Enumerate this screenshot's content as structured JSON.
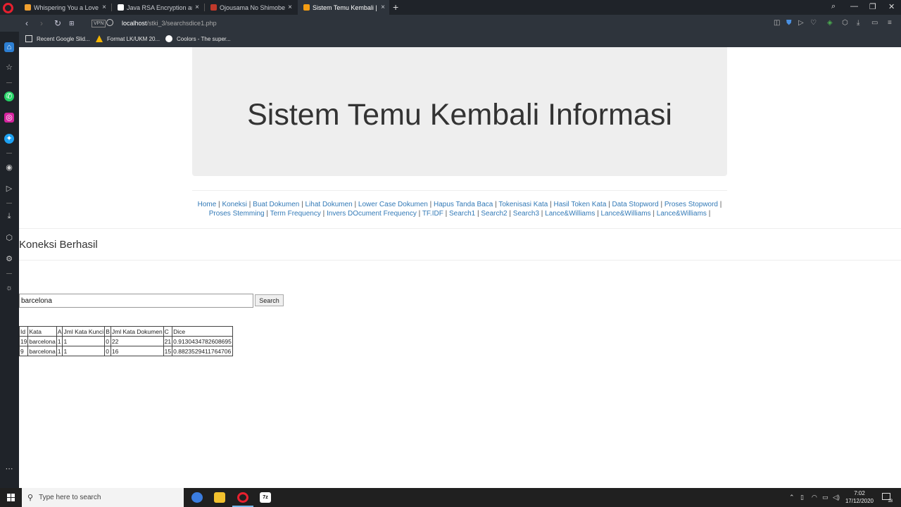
{
  "browser": {
    "tabs": [
      {
        "label": "Whispering You a Love Song",
        "fav_color": "#f0a030"
      },
      {
        "label": "Java RSA Encryption and D",
        "fav_color": "#ffffff"
      },
      {
        "label": "Ojousama No Shimobe Volume",
        "fav_color": "#c0392b"
      },
      {
        "label": "Sistem Temu Kembali | Home",
        "fav_color": "#f39c12"
      }
    ],
    "close_glyph": "×",
    "new_tab_glyph": "+",
    "vpn_label": "VPN",
    "url_host": "localhost",
    "url_path": "/stki_3/searchsdice1.php",
    "bookmarks": [
      {
        "label": "Recent Google Slid...",
        "icon_color": "#dddddd"
      },
      {
        "label": "Format LK/UKM 20...",
        "icon_color": "#f4b400"
      },
      {
        "label": "Coolors - The super...",
        "icon_color": "#ffffff"
      }
    ]
  },
  "page": {
    "title": "Sistem Temu Kembali Informasi",
    "menu": [
      "Home",
      "Koneksi",
      "Buat Dokumen",
      "Lihat Dokumen",
      "Lower Case Dokumen",
      "Hapus Tanda Baca",
      "Tokenisasi Kata",
      "Hasil Token Kata",
      "Data Stopword",
      "Proses Stopword",
      "Proses Stemming",
      "Term Frequency",
      "Invers DOcument Frequency",
      "TF.IDF",
      "Search1",
      "Search2",
      "Search3",
      "Lance&Williams",
      "Lance&Williams",
      "Lance&Williams"
    ],
    "menu_separator": " | ",
    "status": "Koneksi Berhasil",
    "search": {
      "value": "barcelona",
      "button": "Search"
    },
    "table": {
      "headers": [
        "Id",
        "Kata",
        "A",
        "Jml Kata Kunci",
        "B",
        "Jml Kata Dokumen",
        "C",
        "Dice"
      ],
      "rows": [
        [
          "19",
          "barcelona",
          "1",
          "1",
          "0",
          "22",
          "21",
          "0.9130434782608695"
        ],
        [
          "9",
          "barcelona",
          "1",
          "1",
          "0",
          "16",
          "15",
          "0.8823529411764706"
        ]
      ]
    }
  },
  "taskbar": {
    "search_placeholder": "Type here to search",
    "time": "7:02",
    "date": "17/12/2020",
    "notification_count": "18"
  }
}
